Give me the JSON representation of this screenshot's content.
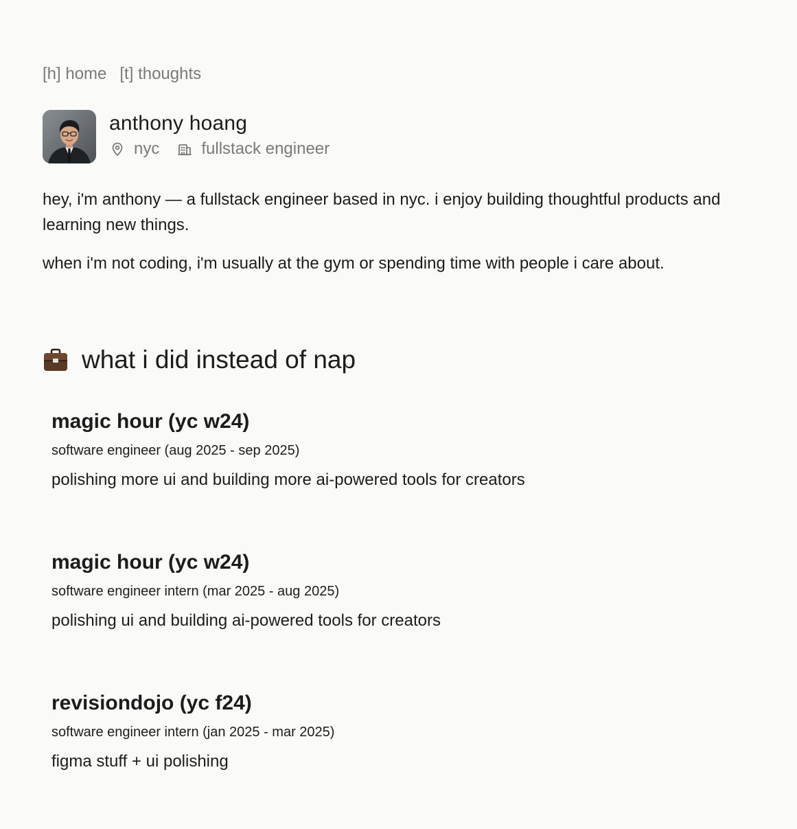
{
  "nav": {
    "home_label": "[h] home",
    "thoughts_label": "[t] thoughts"
  },
  "profile": {
    "name": "anthony hoang",
    "location": "nyc",
    "role": "fullstack engineer",
    "location_icon": "map-pin-icon",
    "role_icon": "building-icon"
  },
  "bio": {
    "paragraph_1": "hey, i'm anthony — a fullstack engineer based in nyc. i enjoy building thoughtful products and learning new things.",
    "paragraph_2": "when i'm not coding, i'm usually at the gym or spending time with people i care about."
  },
  "experience": {
    "icon": "briefcase-icon",
    "title": "what i did instead of nap",
    "jobs": [
      {
        "company": "magic hour (yc w24)",
        "role": "software engineer (aug 2025 - sep 2025)",
        "description": "polishing more ui and building more ai-powered tools for creators"
      },
      {
        "company": "magic hour (yc w24)",
        "role": "software engineer intern (mar 2025 - aug 2025)",
        "description": "polishing ui and building ai-powered tools for creators"
      },
      {
        "company": "revisiondojo (yc f24)",
        "role": "software engineer intern (jan 2025 - mar 2025)",
        "description": "figma stuff + ui polishing"
      }
    ]
  },
  "colors": {
    "background": "#fafaf9",
    "text": "#1c1c1c",
    "muted": "#7a7a7a"
  }
}
